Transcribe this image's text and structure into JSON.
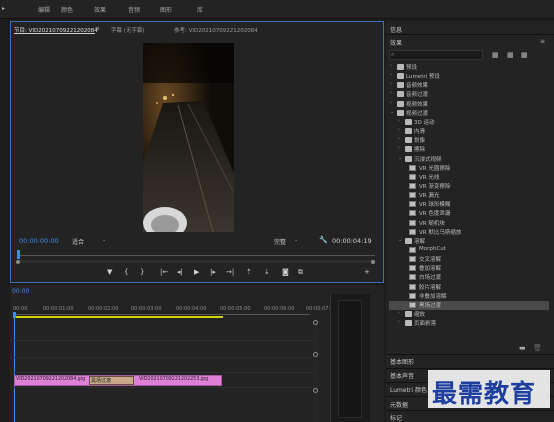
{
  "menu": [
    "编辑",
    "颜色",
    "效果",
    "音频",
    "图形",
    "库"
  ],
  "program_monitor": {
    "tabs": [
      "节目: VID20210709221202084",
      "字幕 (无字幕)",
      "参考: VID20210709221202084"
    ],
    "timecode_current": "00:00:00:00",
    "fit_select": "适合",
    "quality_select": "完整",
    "timecode_duration": "00:00:04:19"
  },
  "timeline": {
    "timecode": "00:00",
    "ruler_ticks": [
      "00:00",
      "00:00:01:00",
      "00:00:02:00",
      "00:00:03:00",
      "00:00:04:00",
      "00:00:05:00",
      "00:00:06:00",
      "00:00:07:00"
    ],
    "clips": [
      {
        "label": "VID20210709221202084.jpg"
      },
      {
        "label": "黑场过渡"
      },
      {
        "label": "VID20210709221202253.jpg"
      }
    ]
  },
  "right_panel": {
    "info_title": "信息",
    "effects_title": "效果",
    "tree": [
      {
        "label": "预设",
        "level": 0,
        "kind": "folder",
        "twisty": ">"
      },
      {
        "label": "Lumetri 预设",
        "level": 0,
        "kind": "folder",
        "twisty": ">"
      },
      {
        "label": "音频效果",
        "level": 0,
        "kind": "folder",
        "twisty": ">"
      },
      {
        "label": "音频过渡",
        "level": 0,
        "kind": "folder",
        "twisty": ">"
      },
      {
        "label": "视频效果",
        "level": 0,
        "kind": "folder",
        "twisty": ">"
      },
      {
        "label": "视频过渡",
        "level": 0,
        "kind": "folder",
        "twisty": "v"
      },
      {
        "label": "3D 运动",
        "level": 1,
        "kind": "folder",
        "twisty": ">"
      },
      {
        "label": "内滑",
        "level": 1,
        "kind": "folder",
        "twisty": ">"
      },
      {
        "label": "划像",
        "level": 1,
        "kind": "folder",
        "twisty": ">"
      },
      {
        "label": "擦除",
        "level": 1,
        "kind": "folder",
        "twisty": ">"
      },
      {
        "label": "沉浸式视频",
        "level": 1,
        "kind": "folder",
        "twisty": "v"
      },
      {
        "label": "VR 光圈擦除",
        "level": 2,
        "kind": "fx"
      },
      {
        "label": "VR 光线",
        "level": 2,
        "kind": "fx"
      },
      {
        "label": "VR 渐变擦除",
        "level": 2,
        "kind": "fx"
      },
      {
        "label": "VR 漏光",
        "level": 2,
        "kind": "fx"
      },
      {
        "label": "VR 球形模糊",
        "level": 2,
        "kind": "fx"
      },
      {
        "label": "VR 色度泄漏",
        "level": 2,
        "kind": "fx"
      },
      {
        "label": "VR 随机块",
        "level": 2,
        "kind": "fx"
      },
      {
        "label": "VR 默比乌斯缩放",
        "level": 2,
        "kind": "fx"
      },
      {
        "label": "溶解",
        "level": 1,
        "kind": "folder",
        "twisty": "v"
      },
      {
        "label": "MorphCut",
        "level": 2,
        "kind": "fx"
      },
      {
        "label": "交叉溶解",
        "level": 2,
        "kind": "fx"
      },
      {
        "label": "叠加溶解",
        "level": 2,
        "kind": "fx"
      },
      {
        "label": "白场过渡",
        "level": 2,
        "kind": "fx"
      },
      {
        "label": "胶片溶解",
        "level": 2,
        "kind": "fx"
      },
      {
        "label": "非叠加溶解",
        "level": 2,
        "kind": "fx"
      },
      {
        "label": "黑场过渡",
        "level": 2,
        "kind": "fx",
        "selected": true
      },
      {
        "label": "缩放",
        "level": 1,
        "kind": "folder",
        "twisty": ">"
      },
      {
        "label": "页面剥落",
        "level": 1,
        "kind": "folder",
        "twisty": ">"
      }
    ],
    "sections": [
      "基本图形",
      "基本声音",
      "Lumetri 颜色",
      "元数据",
      "标记"
    ]
  },
  "watermark": "最需教育",
  "colors": {
    "accent": "#3b8cf0",
    "clip": "#e07fd7",
    "transition": "#c9a98a",
    "playhead_bar": "#d6d600"
  }
}
